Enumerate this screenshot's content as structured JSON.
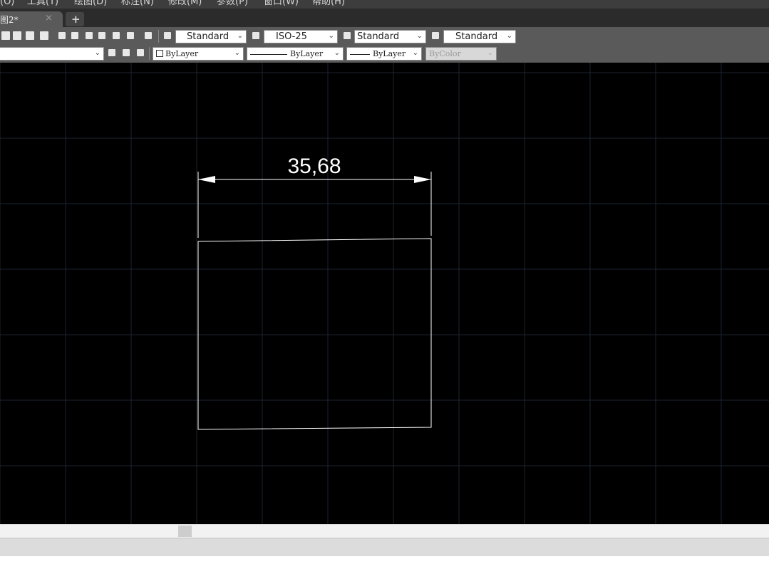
{
  "menu": [
    "(O)",
    "工具(T)",
    "绘图(D)",
    "标注(N)",
    "修改(M)",
    "参数(P)",
    "窗口(W)",
    "帮助(H)"
  ],
  "tabs": [
    {
      "label": "图2*",
      "close": "×"
    }
  ],
  "tab_add": "+",
  "toolbar1": {
    "text_style": "Standard",
    "dim_style": "ISO-25",
    "table_style": "Standard",
    "multileader_style": "Standard"
  },
  "toolbar2": {
    "layer": "",
    "color": "ByLayer",
    "linetype": "ByLayer",
    "lineweight": "ByLayer",
    "plot_style": "ByColor"
  },
  "drawing": {
    "dimension_text": "35,68"
  },
  "icons": {
    "toolbar1": [
      "pan-icon",
      "zoom-realtime-icon",
      "zoom-window-icon",
      "zoom-previous-icon",
      "properties-icon",
      "design-center-icon",
      "tool-palettes-icon",
      "markup-icon",
      "calculator-icon",
      "sheet-set-icon",
      "help-icon",
      "text-style-icon",
      "dim-style-icon",
      "table-style-icon",
      "multileader-style-icon"
    ],
    "toolbar2": [
      "layer-previous-icon",
      "layer-match-icon",
      "layer-state-icon"
    ]
  },
  "colors": {
    "canvas": "#000000",
    "geometry": "#ffffff",
    "grid": "#1c2430"
  }
}
